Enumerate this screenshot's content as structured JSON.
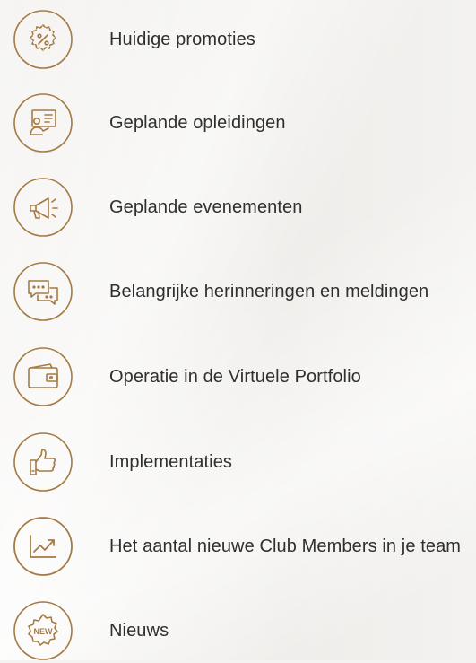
{
  "accent_color": "#a47b45",
  "menu": {
    "items": [
      {
        "label": "Huidige promoties",
        "icon": "percent-badge-icon"
      },
      {
        "label": "Geplande opleidingen",
        "icon": "presentation-board-icon"
      },
      {
        "label": "Geplande evenementen",
        "icon": "megaphone-icon"
      },
      {
        "label": "Belangrijke herinneringen en meldingen",
        "icon": "chat-bubbles-icon"
      },
      {
        "label": "Operatie in de Virtuele Portfolio",
        "icon": "wallet-icon"
      },
      {
        "label": "Implementaties",
        "icon": "thumbs-up-icon"
      },
      {
        "label": "Het aantal nieuwe Club Members in je team",
        "icon": "trend-chart-icon"
      },
      {
        "label": "Nieuws",
        "icon": "new-badge-icon"
      }
    ],
    "new_badge_text": "NEW"
  }
}
